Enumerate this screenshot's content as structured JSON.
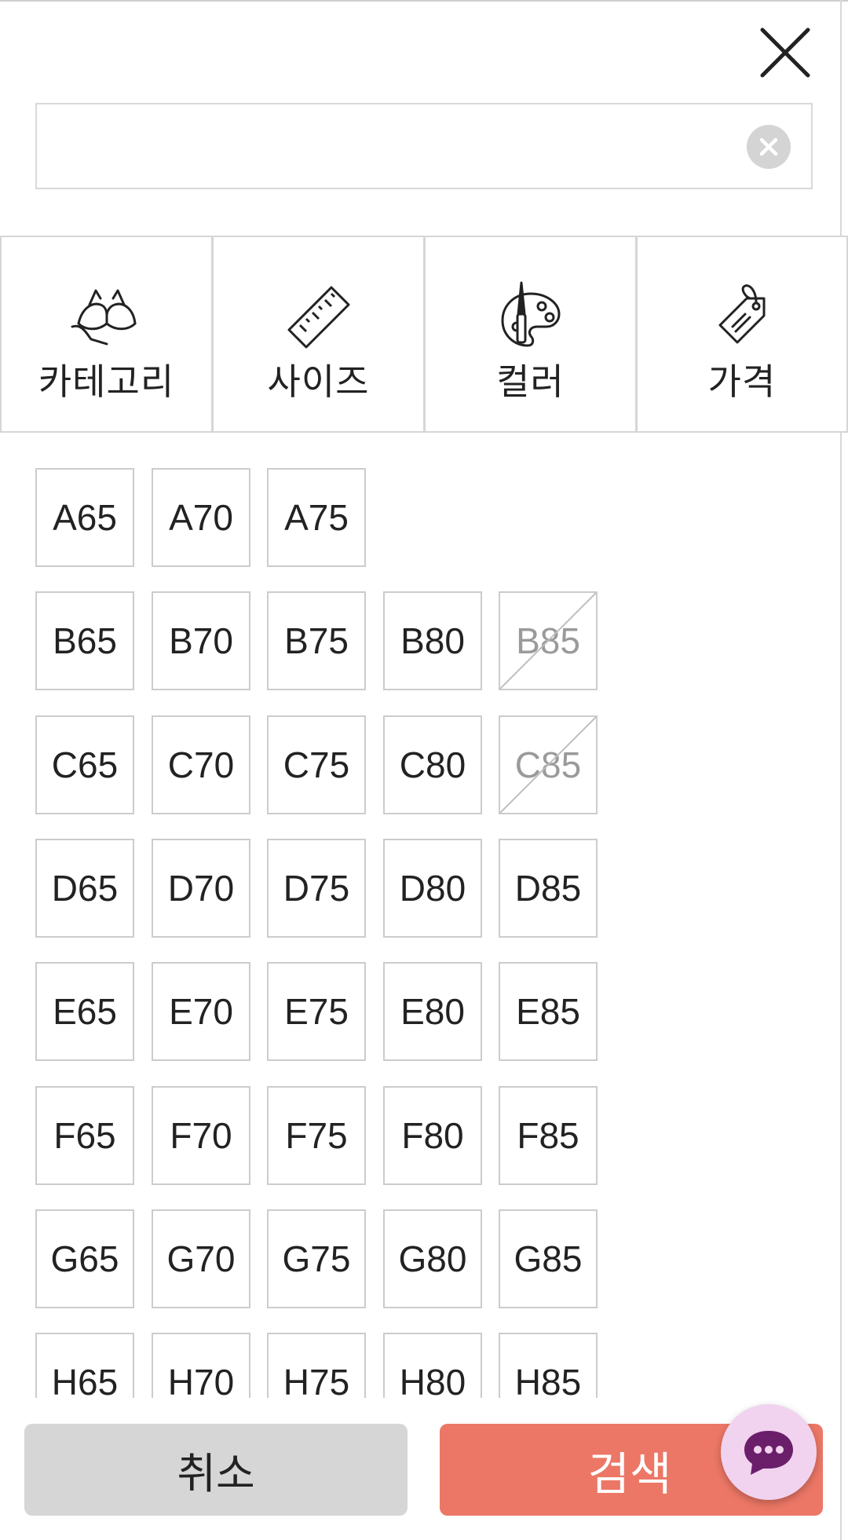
{
  "search": {
    "value": "",
    "placeholder": ""
  },
  "filter_tabs": [
    {
      "label": "카테고리",
      "icon": "bra-icon"
    },
    {
      "label": "사이즈",
      "icon": "ruler-icon"
    },
    {
      "label": "컬러",
      "icon": "palette-icon"
    },
    {
      "label": "가격",
      "icon": "price-tag-icon"
    }
  ],
  "sizes": [
    {
      "row": "A",
      "items": [
        {
          "label": "A65",
          "available": true
        },
        {
          "label": "A70",
          "available": true
        },
        {
          "label": "A75",
          "available": true
        }
      ]
    },
    {
      "row": "B",
      "items": [
        {
          "label": "B65",
          "available": true
        },
        {
          "label": "B70",
          "available": true
        },
        {
          "label": "B75",
          "available": true
        },
        {
          "label": "B80",
          "available": true
        },
        {
          "label": "B85",
          "available": false
        }
      ]
    },
    {
      "row": "C",
      "items": [
        {
          "label": "C65",
          "available": true
        },
        {
          "label": "C70",
          "available": true
        },
        {
          "label": "C75",
          "available": true
        },
        {
          "label": "C80",
          "available": true
        },
        {
          "label": "C85",
          "available": false
        }
      ]
    },
    {
      "row": "D",
      "items": [
        {
          "label": "D65",
          "available": true
        },
        {
          "label": "D70",
          "available": true
        },
        {
          "label": "D75",
          "available": true
        },
        {
          "label": "D80",
          "available": true
        },
        {
          "label": "D85",
          "available": true
        }
      ]
    },
    {
      "row": "E",
      "items": [
        {
          "label": "E65",
          "available": true
        },
        {
          "label": "E70",
          "available": true
        },
        {
          "label": "E75",
          "available": true
        },
        {
          "label": "E80",
          "available": true
        },
        {
          "label": "E85",
          "available": true
        }
      ]
    },
    {
      "row": "F",
      "items": [
        {
          "label": "F65",
          "available": true
        },
        {
          "label": "F70",
          "available": true
        },
        {
          "label": "F75",
          "available": true
        },
        {
          "label": "F80",
          "available": true
        },
        {
          "label": "F85",
          "available": true
        }
      ]
    },
    {
      "row": "G",
      "items": [
        {
          "label": "G65",
          "available": true
        },
        {
          "label": "G70",
          "available": true
        },
        {
          "label": "G75",
          "available": true
        },
        {
          "label": "G80",
          "available": true
        },
        {
          "label": "G85",
          "available": true
        }
      ]
    },
    {
      "row": "H",
      "items": [
        {
          "label": "H65",
          "available": true
        },
        {
          "label": "H70",
          "available": true
        },
        {
          "label": "H75",
          "available": true
        },
        {
          "label": "H80",
          "available": true
        },
        {
          "label": "H85",
          "available": true
        }
      ]
    }
  ],
  "buttons": {
    "cancel": "취소",
    "search": "검색"
  },
  "icons": {
    "close": "close-icon",
    "clear": "clear-icon",
    "chat": "chat-bubble-icon"
  },
  "colors": {
    "accent": "#ec7766",
    "cancel_bg": "#d6d6d6",
    "chat_bg": "#f1d3ef",
    "chat_icon": "#6b1f6b",
    "disabled_text": "#9a9a9a"
  }
}
